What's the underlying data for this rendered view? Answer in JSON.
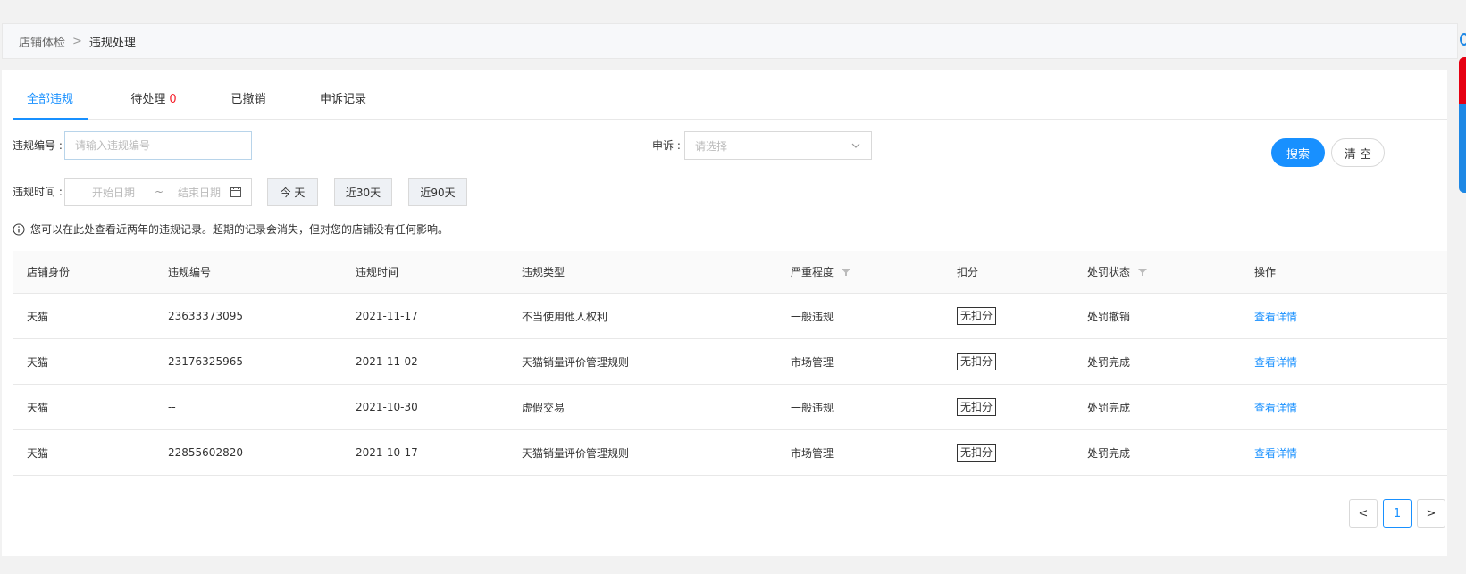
{
  "breadcrumb": {
    "root": "店铺体检",
    "separator": ">",
    "current": "违规处理"
  },
  "tabs": [
    {
      "label": "全部违规",
      "count": ""
    },
    {
      "label": "待处理",
      "count": "0"
    },
    {
      "label": "已撤销",
      "count": ""
    },
    {
      "label": "申诉记录",
      "count": ""
    }
  ],
  "filters": {
    "violation_no_label": "违规编号 :",
    "violation_no_placeholder": "请输入违规编号",
    "appeal_label": "申诉 :",
    "appeal_placeholder": "请选择",
    "time_label": "违规时间 :",
    "start_placeholder": "开始日期",
    "range_sep": "~",
    "end_placeholder": "结束日期",
    "quick": [
      "今 天",
      "近30天",
      "近90天"
    ],
    "search_label": "搜索",
    "clear_label": "清 空"
  },
  "notice": "您可以在此处查看近两年的违规记录。超期的记录会消失，但对您的店铺没有任何影响。",
  "table": {
    "columns": [
      "店铺身份",
      "违规编号",
      "违规时间",
      "违规类型",
      "严重程度",
      "扣分",
      "处罚状态",
      "操作"
    ],
    "rows": [
      [
        "天猫",
        "23633373095",
        "2021-11-17",
        "不当使用他人权利",
        "一般违规",
        "无扣分",
        "处罚撤销",
        "查看详情"
      ],
      [
        "天猫",
        "23176325965",
        "2021-11-02",
        "天猫销量评价管理规则",
        "市场管理",
        "无扣分",
        "处罚完成",
        "查看详情"
      ],
      [
        "天猫",
        "--",
        "2021-10-30",
        "虚假交易",
        "一般违规",
        "无扣分",
        "处罚完成",
        "查看详情"
      ],
      [
        "天猫",
        "22855602820",
        "2021-10-17",
        "天猫销量评价管理规则",
        "市场管理",
        "无扣分",
        "处罚完成",
        "查看详情"
      ]
    ]
  },
  "pagination": {
    "prev": "<",
    "current": "1",
    "next": ">"
  },
  "colors": {
    "accent": "#1890ff",
    "danger": "#f5222d"
  }
}
